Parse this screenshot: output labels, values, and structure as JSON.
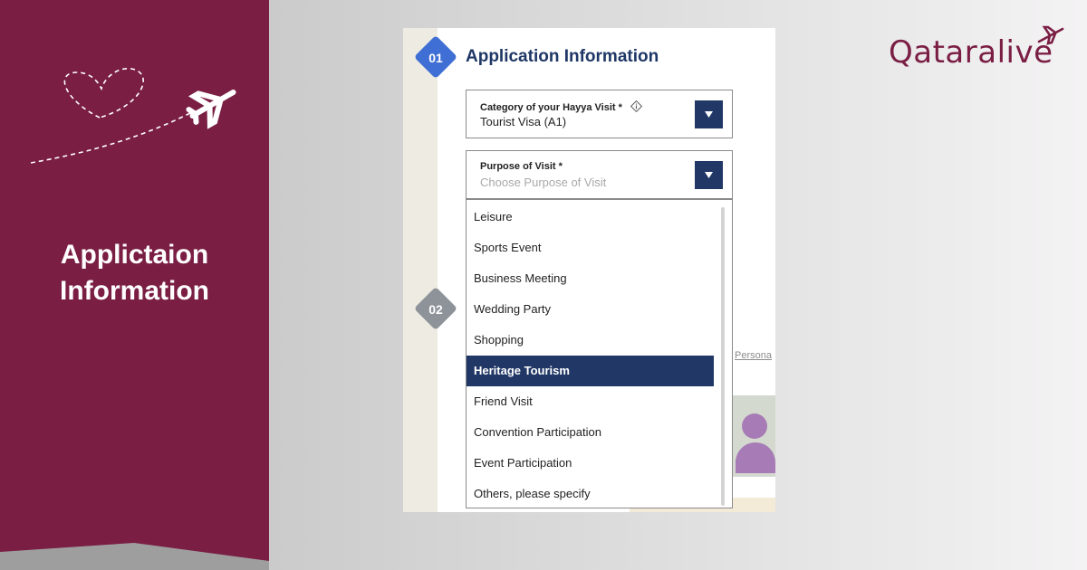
{
  "left_panel": {
    "title_line1": "Applictaion",
    "title_line2": "Information",
    "color": "#7a1e44"
  },
  "logo": {
    "text": "Qataralive"
  },
  "form": {
    "step1": "01",
    "step2": "02",
    "section_title": "Application Information",
    "category_field": {
      "label": "Category of your Hayya Visit *",
      "value": "Tourist Visa (A1)"
    },
    "purpose_field": {
      "label": "Purpose of Visit *",
      "placeholder": "Choose Purpose of Visit"
    },
    "purpose_options": [
      {
        "label": "Leisure",
        "selected": false
      },
      {
        "label": "Sports Event",
        "selected": false
      },
      {
        "label": "Business Meeting",
        "selected": false
      },
      {
        "label": "Wedding Party",
        "selected": false
      },
      {
        "label": "Shopping",
        "selected": false
      },
      {
        "label": "Heritage Tourism",
        "selected": true
      },
      {
        "label": "Friend Visit",
        "selected": false
      },
      {
        "label": "Convention Participation",
        "selected": false
      },
      {
        "label": "Event Participation",
        "selected": false
      },
      {
        "label": "Others, please specify",
        "selected": false
      }
    ],
    "background_fragment": "Persona",
    "accent_color": "#213866",
    "step1_color": "#3f6fd4"
  }
}
